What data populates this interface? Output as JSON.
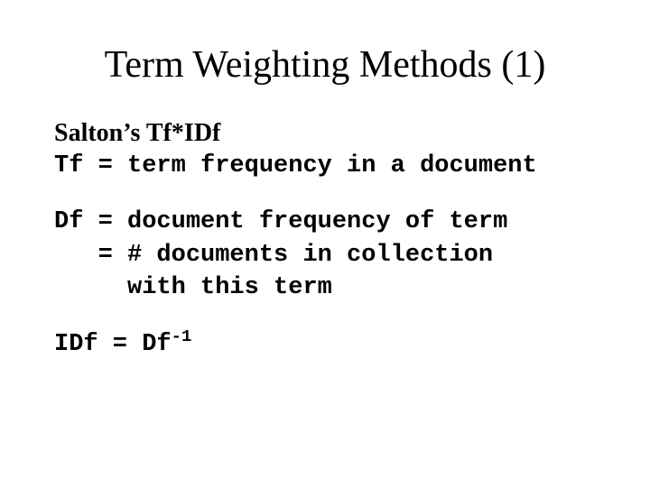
{
  "title": "Term Weighting Methods (1)",
  "subtitle": "Salton’s Tf*IDf",
  "tf_line": "Tf = term frequency in a document",
  "df_line1": "Df = document frequency of term",
  "df_line2": "   = # documents in collection",
  "df_line3": "     with this term",
  "idf_prefix": "IDf = Df",
  "idf_exp": "-1"
}
